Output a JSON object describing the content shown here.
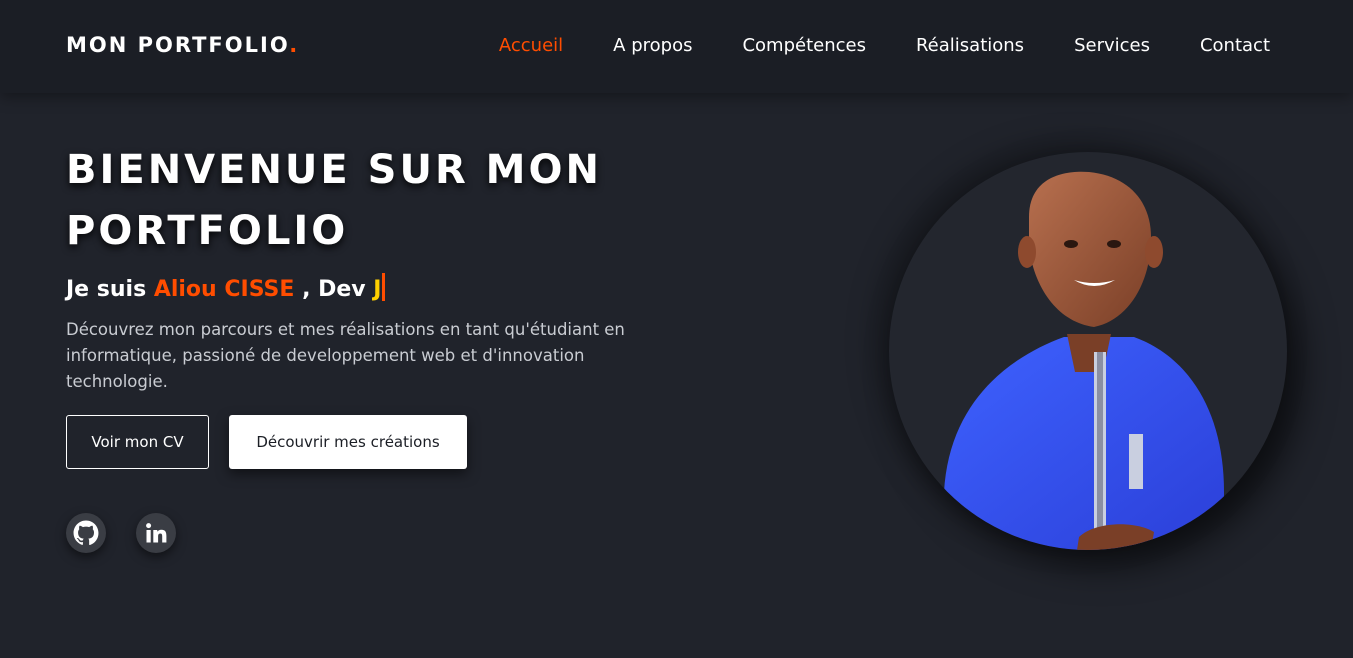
{
  "header": {
    "logo": "MON PORTFOLIO",
    "logo_dot": ".",
    "nav": [
      {
        "label": "Accueil",
        "active": true
      },
      {
        "label": "A propos"
      },
      {
        "label": "Compétences"
      },
      {
        "label": "Réalisations"
      },
      {
        "label": "Services"
      },
      {
        "label": "Contact"
      }
    ]
  },
  "hero": {
    "title": "BIENVENUE SUR MON PORTFOLIO",
    "intro_prefix": "Je suis ",
    "name": "Aliou CISSE",
    "role_prefix": " , Dev ",
    "typed": "J",
    "description": "Découvrez mon parcours et mes réalisations en tant qu'étudiant en informatique, passioné de developpement web et d'innovation technologie.",
    "buttons": {
      "cv": "Voir mon CV",
      "creations": "Découvrir mes créations"
    },
    "social": [
      {
        "icon": "github-icon"
      },
      {
        "icon": "linkedin-icon"
      }
    ]
  },
  "colors": {
    "accent": "#ff4d00",
    "background": "#20232b",
    "header": "#1b1e25",
    "typed": "#ffd000",
    "robe": "#3350f0"
  },
  "photo": {
    "icon": "profile-photo"
  }
}
